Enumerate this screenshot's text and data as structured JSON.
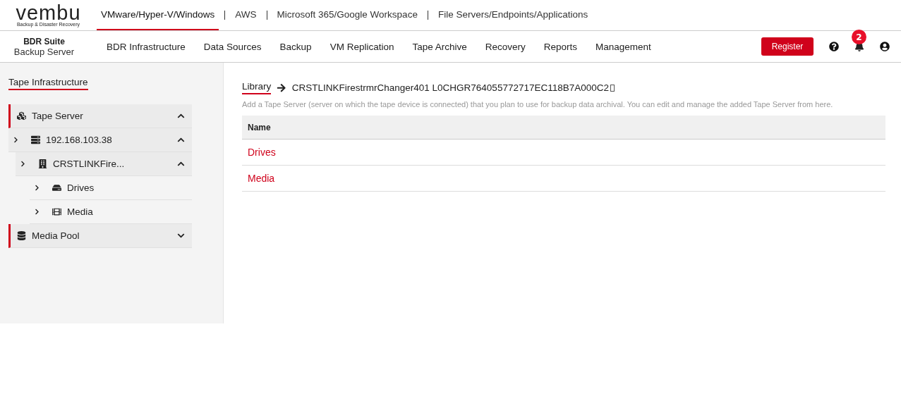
{
  "logo": {
    "name": "vembu",
    "tagline": "Backup & Disaster Recovery"
  },
  "product_tabs": [
    {
      "label": "VMware/Hyper-V/Windows",
      "selected": true
    },
    {
      "label": "AWS",
      "selected": false
    },
    {
      "label": "Microsoft 365/Google Workspace",
      "selected": false
    },
    {
      "label": "File Servers/Endpoints/Applications",
      "selected": false
    }
  ],
  "product": {
    "suite": "BDR Suite",
    "server": "Backup Server"
  },
  "nav": [
    {
      "label": "BDR Infrastructure"
    },
    {
      "label": "Data Sources"
    },
    {
      "label": "Backup"
    },
    {
      "label": "VM Replication"
    },
    {
      "label": "Tape Archive"
    },
    {
      "label": "Recovery"
    },
    {
      "label": "Reports"
    },
    {
      "label": "Management"
    }
  ],
  "register_button": "Register",
  "notifications": {
    "count": "2"
  },
  "sidebar": {
    "title": "Tape Infrastructure",
    "items": [
      {
        "label": "Tape Server",
        "kind": "tape-server",
        "expanded": true,
        "children": [
          {
            "label": "192.168.103.38",
            "kind": "server",
            "expanded": true,
            "children": [
              {
                "label": "CRSTLINKFire...",
                "kind": "library",
                "expanded": true,
                "children": [
                  {
                    "label": "Drives",
                    "kind": "drive"
                  },
                  {
                    "label": "Media",
                    "kind": "media"
                  }
                ]
              }
            ]
          }
        ]
      },
      {
        "label": "Media Pool",
        "kind": "media-pool",
        "expanded": false
      }
    ]
  },
  "breadcrumb": {
    "root": "Library",
    "current": "CRSTLINKFirestrmrChanger401 L0CHGR764055772717EC118B7A000C2"
  },
  "description": "Add a Tape Server (server on which the tape device is connected) that you plan to use for backup data archival. You can edit and manage the added Tape Server from here.",
  "table": {
    "columns": [
      "Name"
    ],
    "rows": [
      [
        "Drives"
      ],
      [
        "Media"
      ]
    ]
  }
}
